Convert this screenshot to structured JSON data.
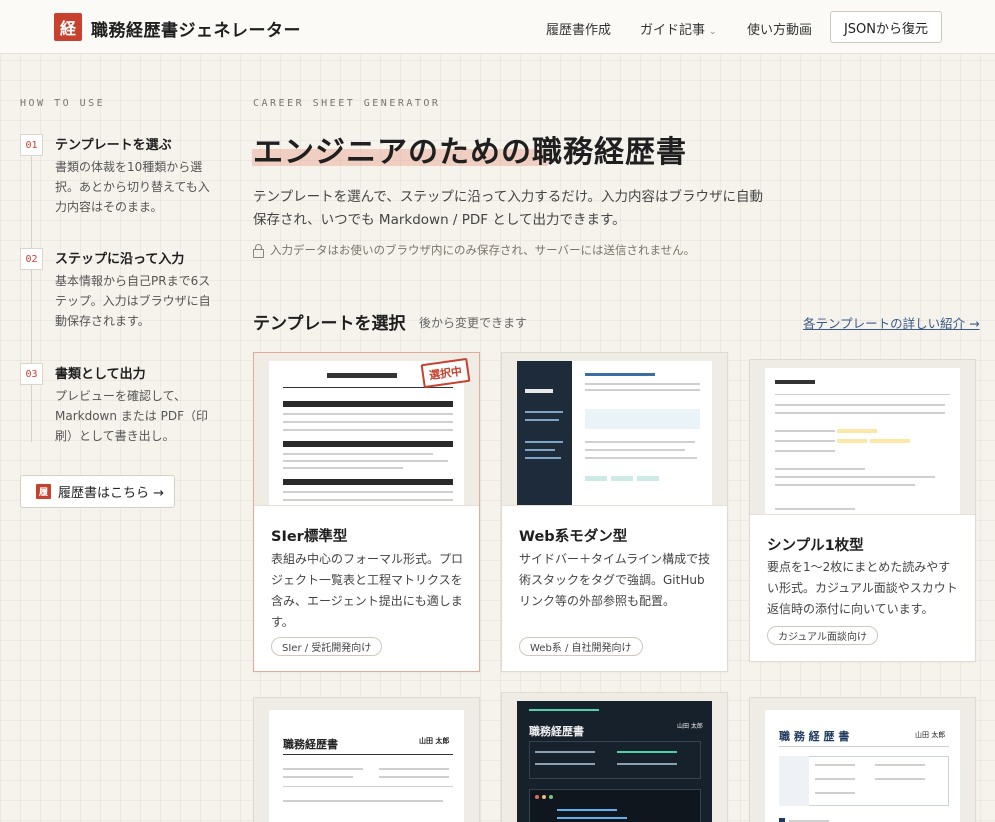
{
  "header": {
    "logo_char": "経",
    "app_title": "職務経歴書ジェネレーター",
    "nav": [
      {
        "label": "履歴書作成"
      },
      {
        "label": "ガイド記事"
      },
      {
        "label": "使い方動画"
      }
    ],
    "json_restore_label": "JSONから復元"
  },
  "sidebar": {
    "heading": "HOW TO USE",
    "steps": [
      {
        "num": "01",
        "title": "テンプレートを選ぶ",
        "desc": "書類の体裁を10種類から選択。あとから切り替えても入力内容はそのまま。"
      },
      {
        "num": "02",
        "title": "ステップに沿って入力",
        "desc": "基本情報から自己PRまで6ステップ。入力はブラウザに自動保存されます。"
      },
      {
        "num": "03",
        "title": "書類として出力",
        "desc": "プレビューを確認して、Markdown または PDF（印刷）として書き出し。"
      }
    ],
    "resume_button": {
      "icon_char": "履",
      "label": "履歴書はこちら →"
    }
  },
  "hero": {
    "eyebrow": "CAREER SHEET GENERATOR",
    "title": "エンジニアのための職務経歴書",
    "description": "テンプレートを選んで、ステップに沿って入力するだけ。入力内容はブラウザに自動保存され、いつでも Markdown / PDF として出力できます。",
    "privacy_note": "入力データはお使いのブラウザ内にのみ保存され、サーバーには送信されません。"
  },
  "templates": {
    "section_title": "テンプレートを選択",
    "section_subtitle": "後から変更できます",
    "details_link": "各テンプレートの詳しい紹介 →",
    "selected_stamp": "選択中",
    "cards": [
      {
        "title": "SIer標準型",
        "desc": "表組み中心のフォーマル形式。プロジェクト一覧表と工程マトリクスを含み、エージェント提出にも適します。",
        "tag": "SIer / 受託開発向け"
      },
      {
        "title": "Web系モダン型",
        "desc": "サイドバー＋タイムライン構成で技術スタックをタグで強調。GitHubリンク等の外部参照も配置。",
        "tag": "Web系 / 自社開発向け"
      },
      {
        "title": "シンプル1枚型",
        "desc": "要点を1〜2枚にまとめた読みやすい形式。カジュアル面談やスカウト返信時の添付に向いています。",
        "tag": "カジュアル面談向け"
      }
    ],
    "lower_previews": [
      {
        "doc_title": "職務経歴書",
        "name": "山田 太郎"
      },
      {
        "doc_title": "職務経歴書",
        "name": "山田 太郎"
      },
      {
        "doc_title": "職 務 経 歴 書",
        "name": "山田 太郎"
      }
    ]
  },
  "colors": {
    "accent": "#c8402e",
    "page_bg": "#f6f3ec",
    "link": "#3a5a8a",
    "highlight": "#e8a591"
  }
}
